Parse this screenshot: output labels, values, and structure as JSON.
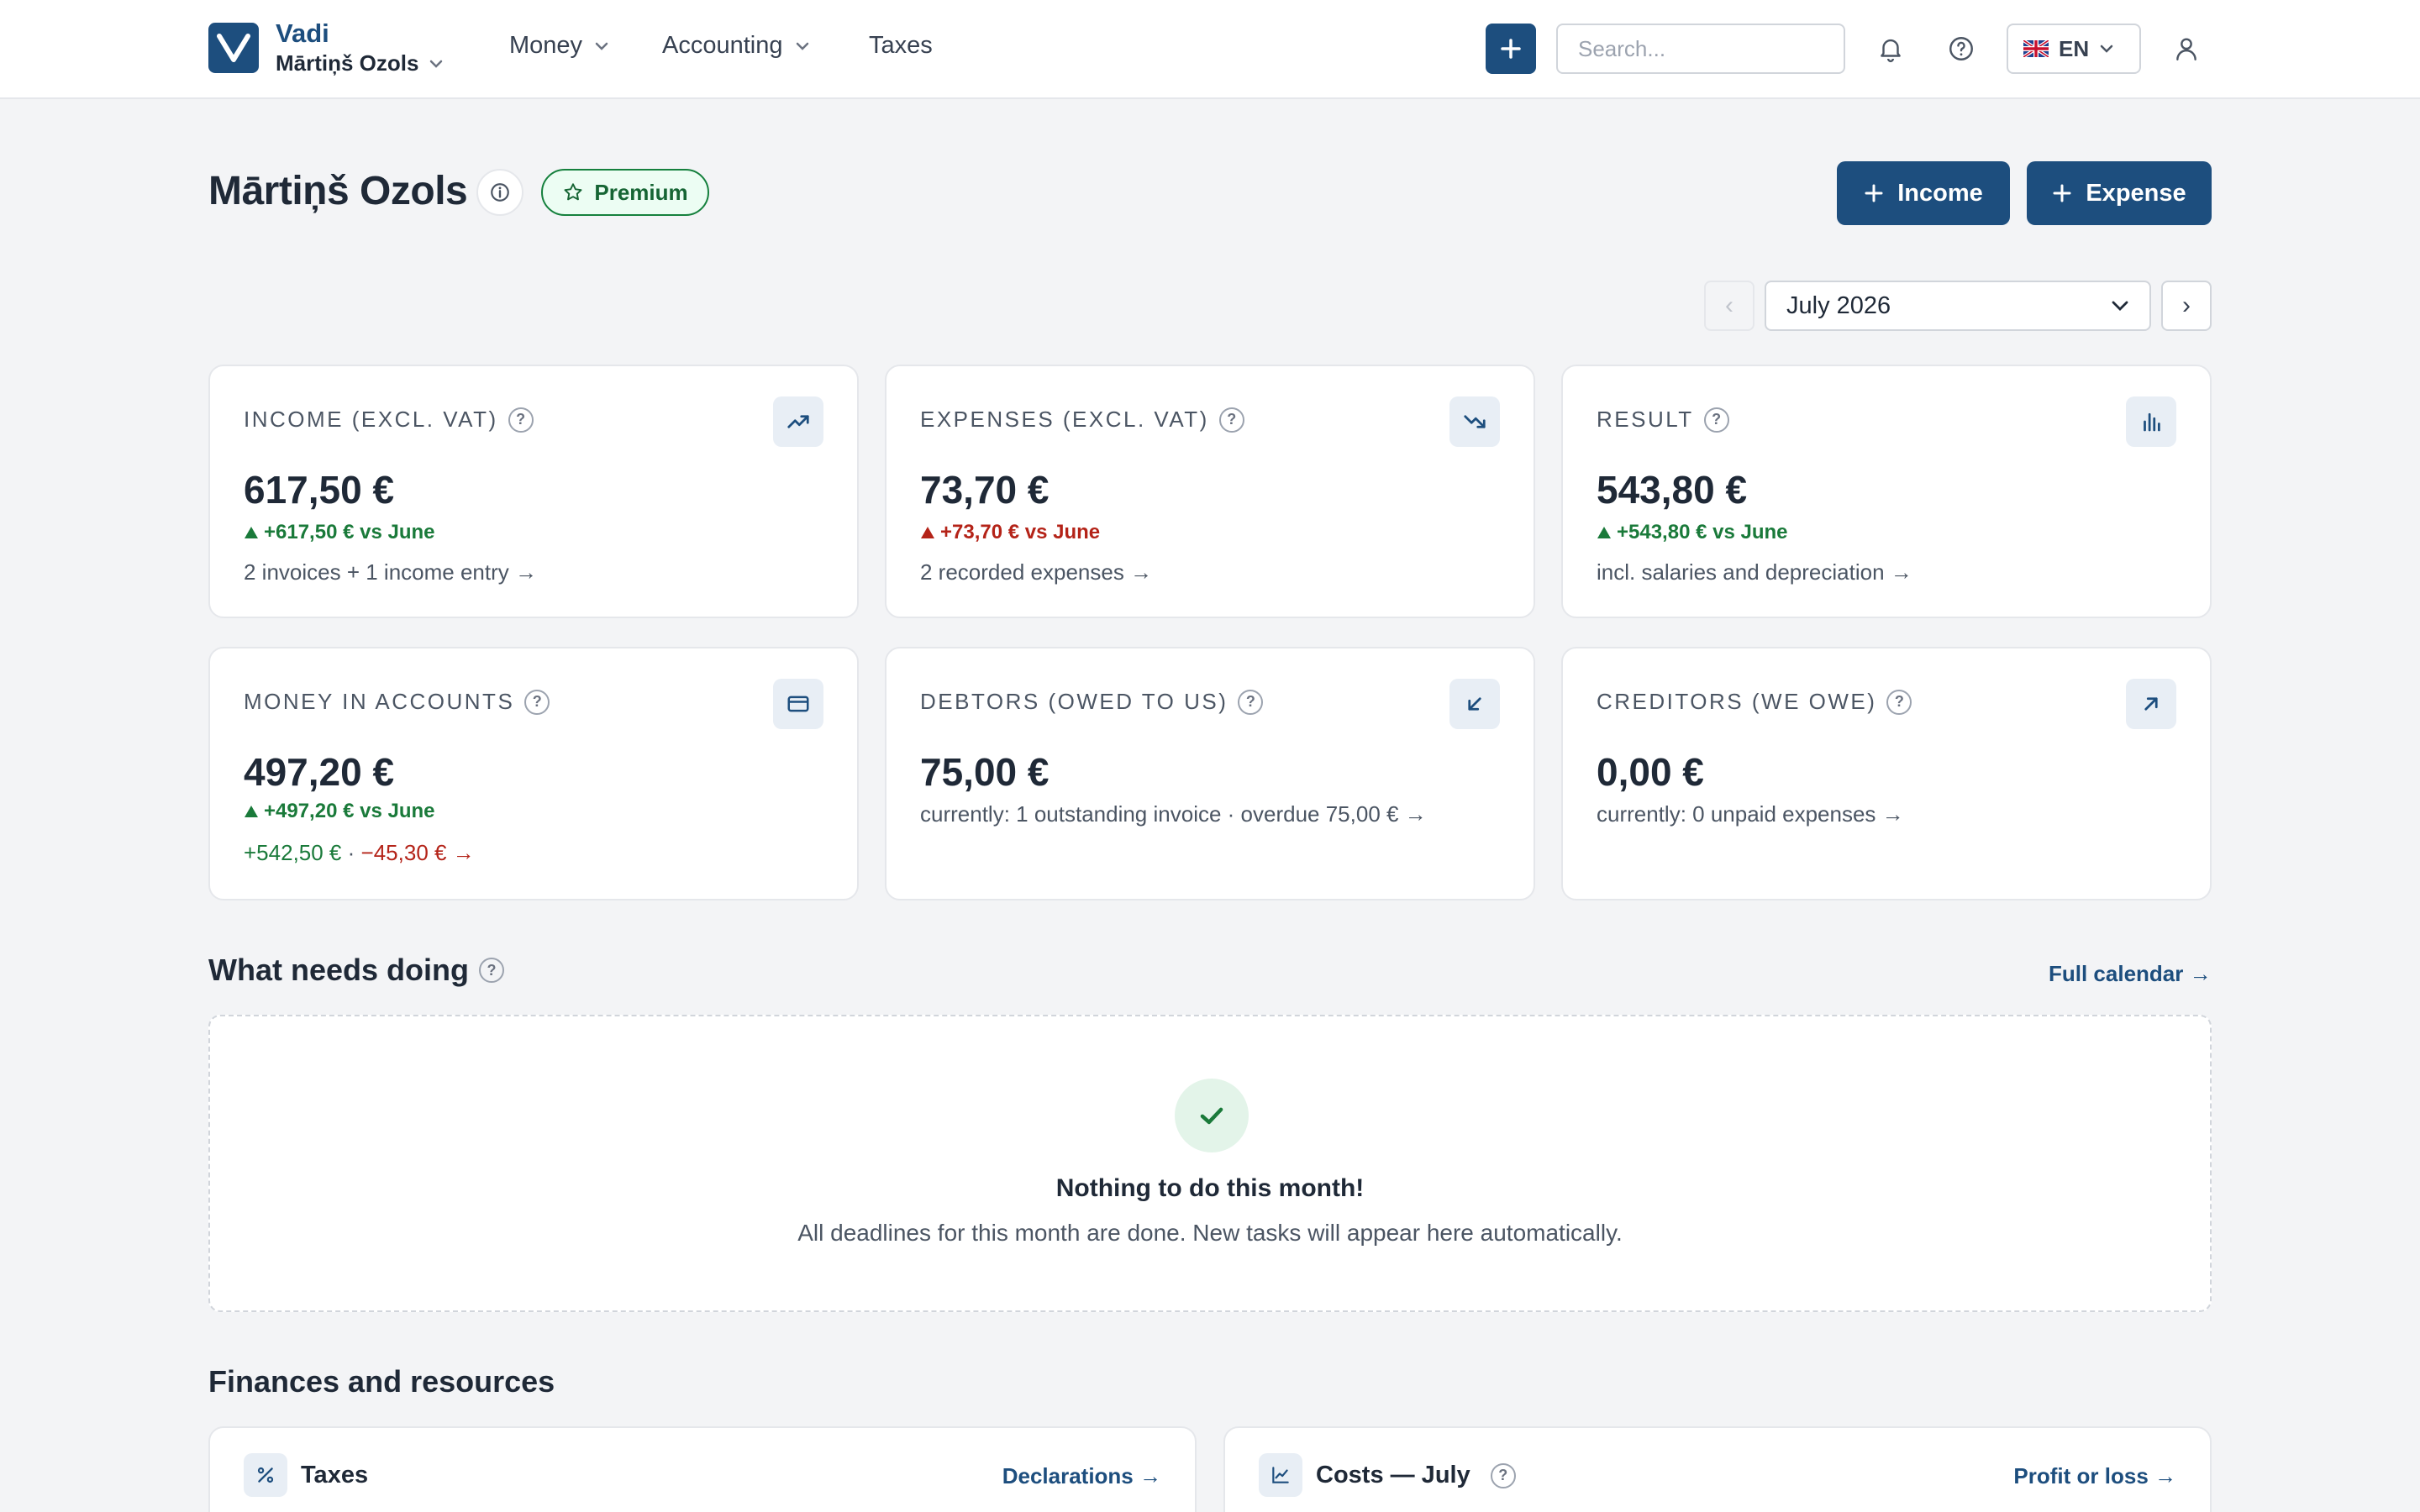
{
  "brand": {
    "name": "Vadi",
    "org_name": "Mārtiņš Ozols",
    "logo_icon": "v-logo-icon",
    "accent": "#1d4e7e"
  },
  "nav": {
    "money": "Money",
    "accounting": "Accounting",
    "taxes": "Taxes"
  },
  "search": {
    "placeholder": "Search..."
  },
  "lang": {
    "code": "EN",
    "flag_icon": "uk-flag-icon"
  },
  "header": {
    "title": "Mārtiņš Ozols",
    "badge": "Premium",
    "income_button": "Income",
    "expense_button": "Expense"
  },
  "period": {
    "value": "July 2026",
    "prev": "‹",
    "next": "›"
  },
  "cards": {
    "income": {
      "label": "INCOME (EXCL. VAT)",
      "value": "617,50 €",
      "change": "+617,50 € vs June",
      "link": "2 invoices + 1 income entry →",
      "icon": "trending-up-icon"
    },
    "expenses": {
      "label": "EXPENSES (EXCL. VAT)",
      "value": "73,70 €",
      "change": "+73,70 € vs June",
      "link": "2 recorded expenses →",
      "icon": "trending-down-icon"
    },
    "result": {
      "label": "RESULT",
      "value": "543,80 €",
      "change": "+543,80 € vs June",
      "link": "incl. salaries and depreciation →",
      "icon": "bar-chart-icon"
    },
    "money": {
      "label": "MONEY IN ACCOUNTS",
      "value": "497,20 €",
      "change": "+497,20 € vs June",
      "in": "+542,50 €",
      "sep": "·",
      "out": "−45,30 € →",
      "icon": "card-icon"
    },
    "debtors": {
      "label": "DEBTORS (OWED TO US)",
      "value": "75,00 €",
      "link": "currently: 1 outstanding invoice · overdue 75,00 € →",
      "icon": "arrow-down-left-icon"
    },
    "creditors": {
      "label": "CREDITORS (WE OWE)",
      "value": "0,00 €",
      "link": "currently: 0 unpaid expenses →",
      "icon": "arrow-up-right-icon"
    }
  },
  "tasks": {
    "title": "What needs doing",
    "calendar_link": "Full calendar →",
    "empty_title": "Nothing to do this month!",
    "empty_sub": "All deadlines for this month are done. New tasks will appear here automatically."
  },
  "finances": {
    "title": "Finances and resources",
    "taxes": {
      "title": "Taxes",
      "link": "Declarations →",
      "icon": "percent-icon"
    },
    "costs": {
      "title": "Costs — July",
      "link": "Profit or loss →",
      "icon": "line-chart-icon"
    }
  },
  "help_mark": "?",
  "colors": {
    "positive": "#1a7a3a",
    "negative": "#b42318",
    "premium": "#15803d"
  }
}
